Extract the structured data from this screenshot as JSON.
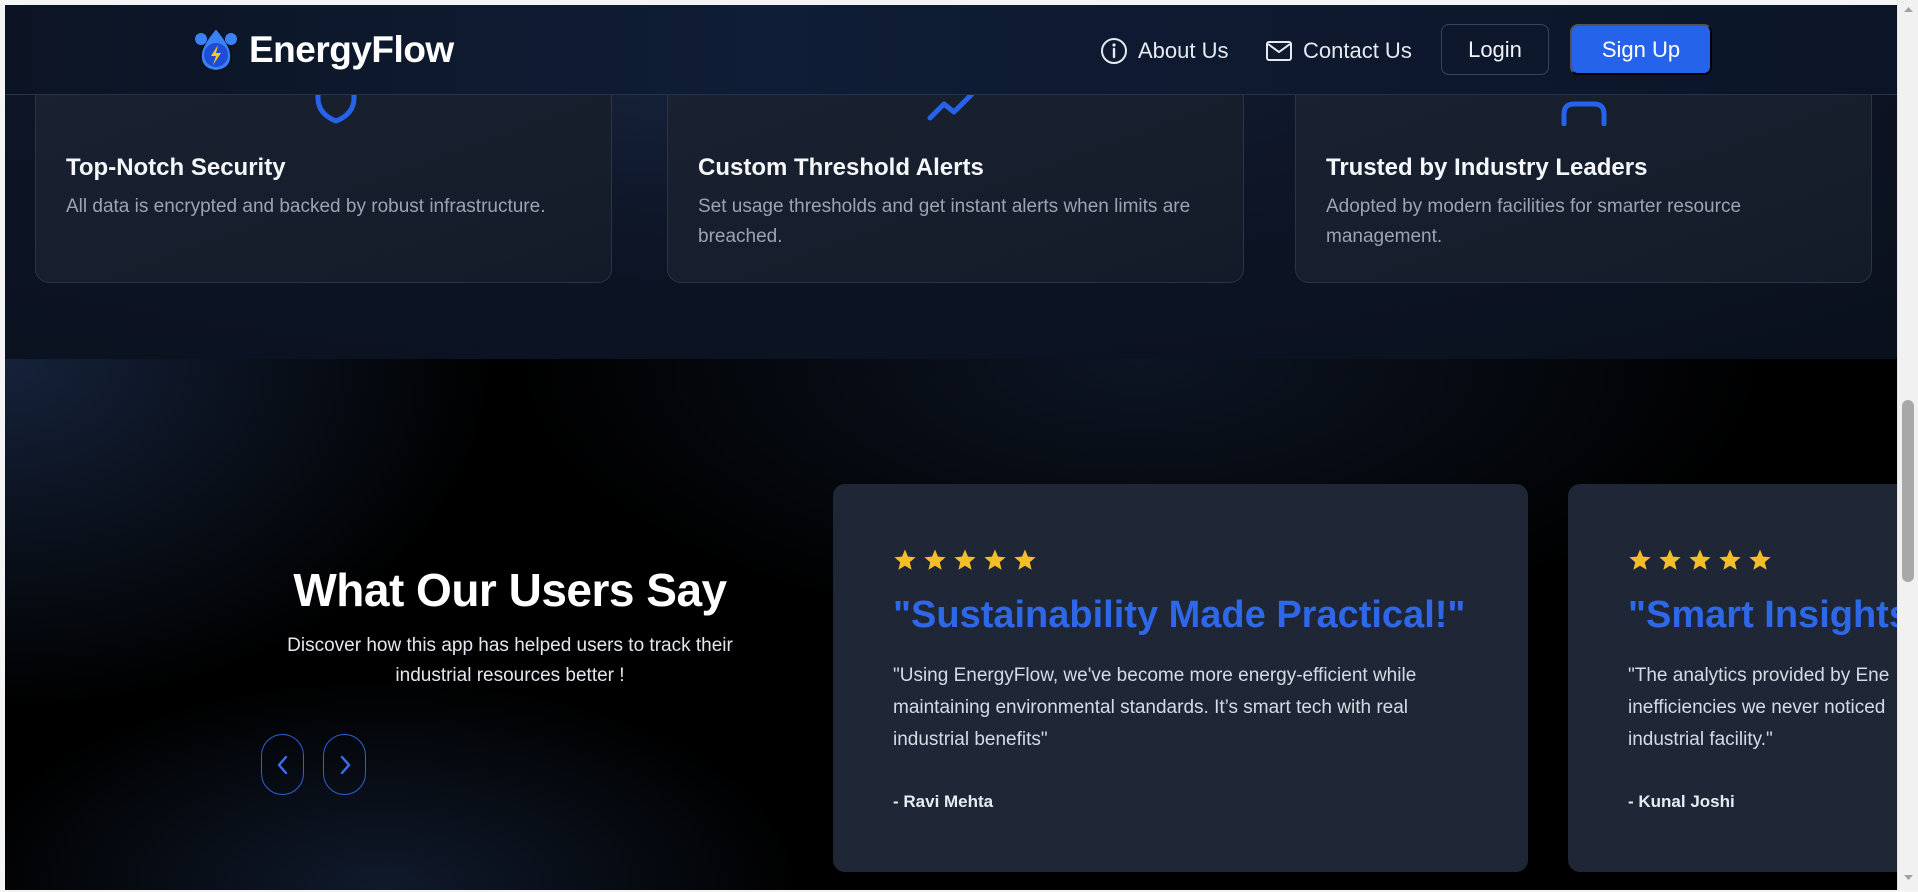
{
  "header": {
    "brand": "EnergyFlow",
    "nav": [
      {
        "label": "About Us",
        "icon": "info-icon"
      },
      {
        "label": "Contact Us",
        "icon": "mail-icon"
      }
    ],
    "login_label": "Login",
    "signup_label": "Sign Up"
  },
  "features": [
    {
      "title": "Top-Notch Security",
      "description": "All data is encrypted and backed by robust infrastructure.",
      "icon": "shield-icon"
    },
    {
      "title": "Custom Threshold Alerts",
      "description": "Set usage thresholds and get instant alerts when limits are breached.",
      "icon": "trend-icon"
    },
    {
      "title": "Trusted by Industry Leaders",
      "description": "Adopted by modern facilities for smarter resource management.",
      "icon": "users-icon"
    }
  ],
  "testimonials": {
    "heading": "What Our Users Say",
    "subheading": "Discover how this app has helped users to track their industrial resources better !",
    "prev_label": "‹",
    "next_label": "›",
    "cards": [
      {
        "rating": 5,
        "title": "\"Sustainability Made Practical!\"",
        "quote": "\"Using EnergyFlow, we've become more energy-efficient while maintaining environmental standards. It’s smart tech with real industrial benefits\"",
        "author": "- Ravi Mehta"
      },
      {
        "rating": 5,
        "title": "\"Smart Insights",
        "quote": "\"The analytics provided by Ene inefficiencies we never noticed industrial facility.\"",
        "author": "- Kunal Joshi"
      }
    ]
  },
  "colors": {
    "accent": "#2563eb",
    "star": "#f4bd2a",
    "card_bg": "#1f2736",
    "page_bg": "#0b1220"
  }
}
